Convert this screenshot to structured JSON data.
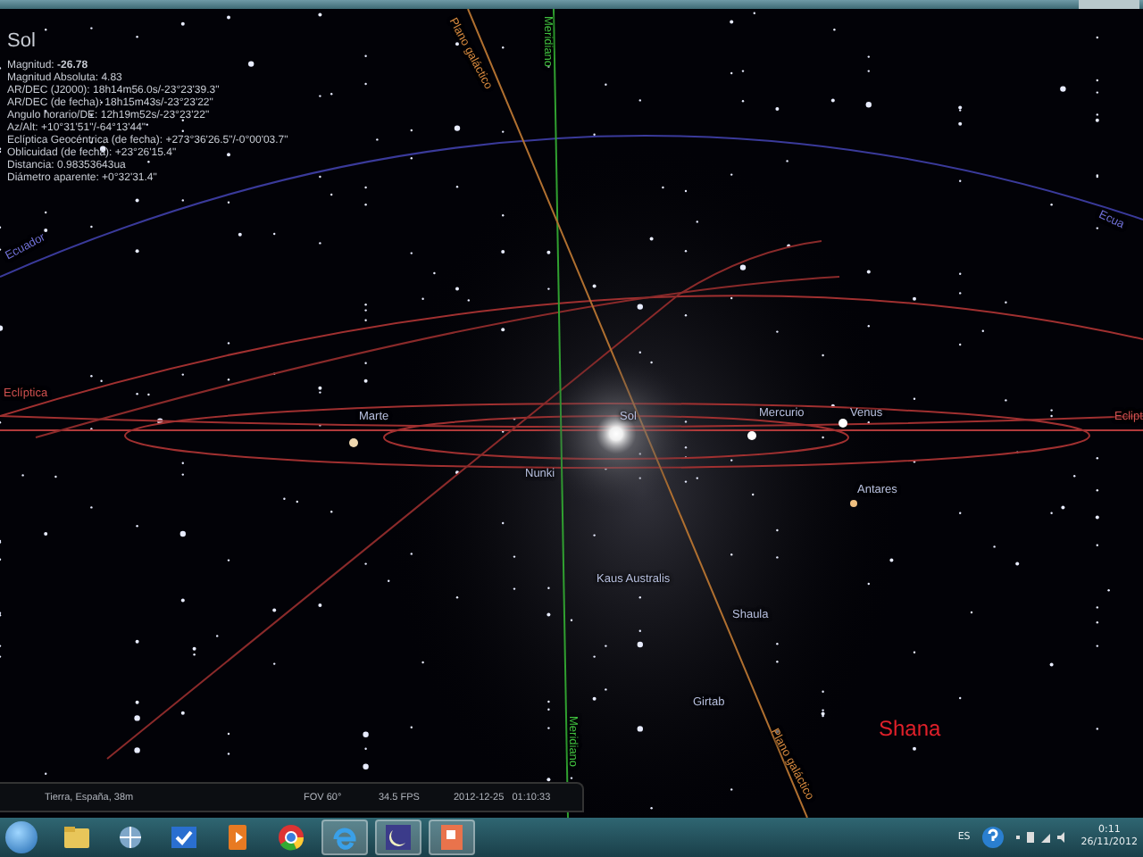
{
  "object_info": {
    "name": "Sol",
    "lines": [
      "Magnitud: **-26.78**",
      "Magnitud Absoluta: 4.83",
      "AR/DEC (J2000): 18h14m56.0s/-23°23'39.3\"",
      "AR/DEC (de fecha): 18h15m43s/-23°23'22\"",
      "Angulo horario/DE: 12h19m52s/-23°23'22\"",
      "Az/Alt: +10°31'51\"/-64°13'44\"",
      "Eclíptica Geocéntrica (de fecha): +273°36'26.5\"/-0°00'03.7\"",
      "Oblicuidad (de fecha): +23°26'15.4\"",
      "Distancia: 0.98353643ua",
      "Diámetro aparente: +0°32'31.4\""
    ]
  },
  "sky_labels": [
    {
      "text": "Plano galáctico",
      "kind": "galactic"
    },
    {
      "text": "Meridiano",
      "kind": "meridian"
    },
    {
      "text": "Ecua",
      "kind": "equator"
    },
    {
      "text": "Ecuador",
      "kind": "equator"
    },
    {
      "text": "Eclíptica",
      "kind": "ecliptic"
    },
    {
      "text": "Marte",
      "kind": "planet"
    },
    {
      "text": "Sol",
      "kind": "planet"
    },
    {
      "text": "Mercurio",
      "kind": "planet"
    },
    {
      "text": "Venus",
      "kind": "planet"
    },
    {
      "text": "Eclipt",
      "kind": "ecliptic"
    },
    {
      "text": "Nunki",
      "kind": "star"
    },
    {
      "text": "Antares",
      "kind": "star"
    },
    {
      "text": "Kaus Australis",
      "kind": "star"
    },
    {
      "text": "Shaula",
      "kind": "star"
    },
    {
      "text": "Girtab",
      "kind": "star"
    },
    {
      "text": "Meridiano",
      "kind": "meridian"
    },
    {
      "text": "Plano galáctico",
      "kind": "galactic"
    }
  ],
  "overlay_text": "Shana",
  "status_bar": {
    "location": "Tierra, España, 38m",
    "fov": "FOV 60°",
    "fps": "34.5 FPS",
    "datetime": "2012-12-25   01:10:33"
  },
  "taskbar": {
    "apps": [
      {
        "kind": "folder",
        "running": false
      },
      {
        "kind": "network",
        "running": false
      },
      {
        "kind": "check",
        "running": false
      },
      {
        "kind": "media",
        "running": false
      },
      {
        "kind": "chrome",
        "running": false
      },
      {
        "kind": "ie",
        "running": true
      },
      {
        "kind": "stellarium",
        "running": true
      },
      {
        "kind": "powerpoint",
        "running": true
      }
    ],
    "language": "ES",
    "time": "0:11",
    "date": "26/11/2012"
  }
}
